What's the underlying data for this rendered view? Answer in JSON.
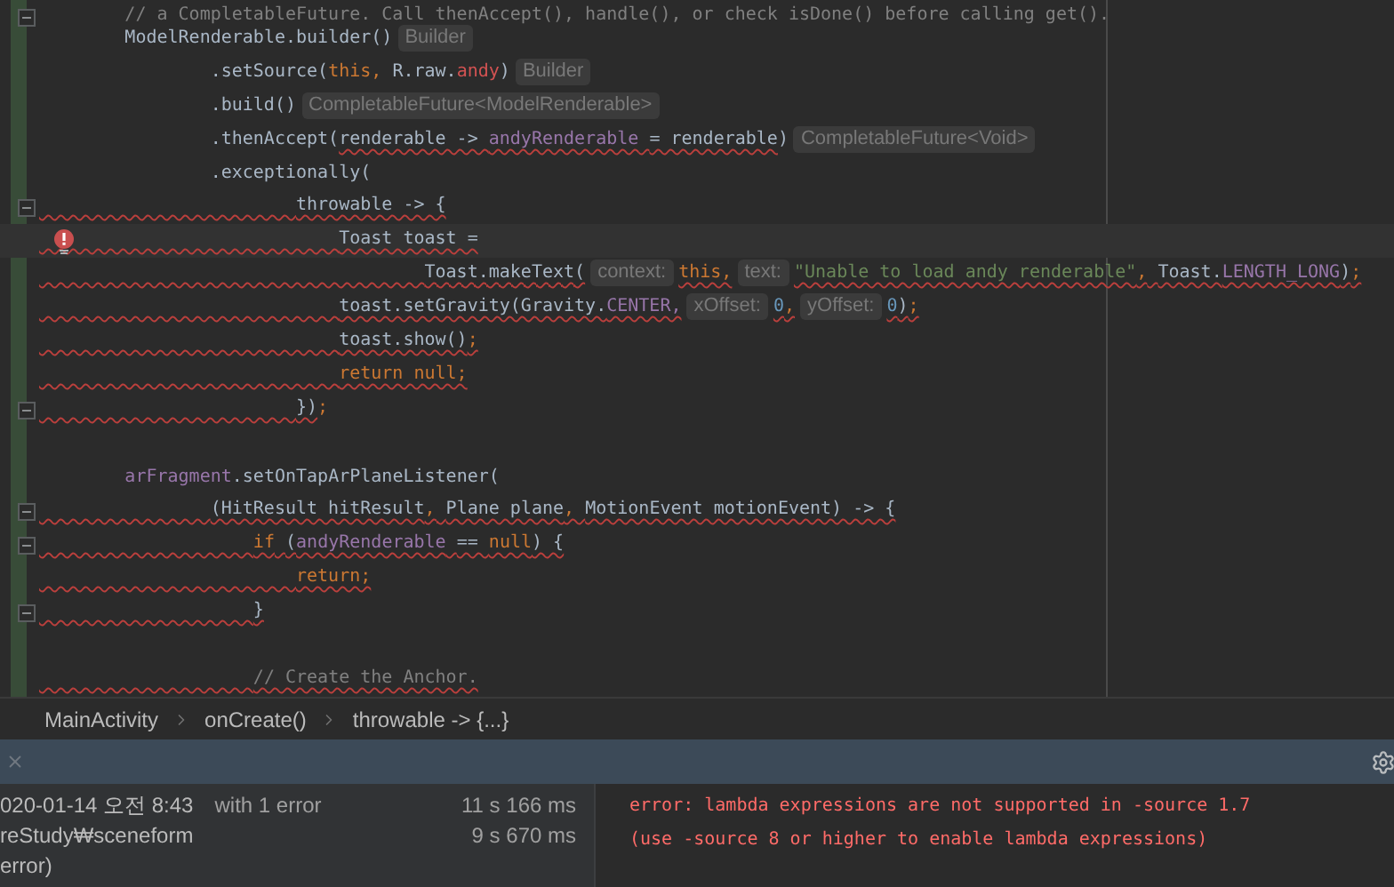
{
  "editor": {
    "lines": [
      {
        "current": false,
        "error_bulb": false,
        "fold": true,
        "tokens": [
          {
            "text": "        // a CompletableFuture. Call thenAccept(), handle(), or check isDone() before calling get().",
            "kind": "comment",
            "error": false
          }
        ]
      },
      {
        "current": false,
        "error_bulb": false,
        "fold": false,
        "tokens": [
          {
            "text": "        ModelRenderable.builder()",
            "kind": "plain",
            "error": false
          },
          {
            "text": "Builder",
            "kind": "hint"
          }
        ]
      },
      {
        "current": false,
        "error_bulb": false,
        "fold": false,
        "tokens": [
          {
            "text": "                .setSource(",
            "kind": "plain",
            "error": false
          },
          {
            "text": "this,",
            "kind": "keyword",
            "error": false
          },
          {
            "text": " R.raw.",
            "kind": "plain",
            "error": false
          },
          {
            "text": "andy",
            "kind": "resource",
            "error": false
          },
          {
            "text": ")",
            "kind": "plain",
            "error": false
          },
          {
            "text": "Builder",
            "kind": "hint"
          }
        ]
      },
      {
        "current": false,
        "error_bulb": false,
        "fold": false,
        "tokens": [
          {
            "text": "                .build()",
            "kind": "plain",
            "error": false
          },
          {
            "text": "CompletableFuture<ModelRenderable>",
            "kind": "hint"
          }
        ]
      },
      {
        "current": false,
        "error_bulb": false,
        "fold": false,
        "tokens": [
          {
            "text": "                .thenAccept(",
            "kind": "plain",
            "error": false
          },
          {
            "text": "renderable -> ",
            "kind": "plain",
            "error": true
          },
          {
            "text": "andyRenderable",
            "kind": "field",
            "error": true
          },
          {
            "text": " = renderable",
            "kind": "plain",
            "error": true
          },
          {
            "text": ")",
            "kind": "plain",
            "error": false
          },
          {
            "text": "CompletableFuture<Void>",
            "kind": "hint"
          }
        ]
      },
      {
        "current": false,
        "error_bulb": false,
        "fold": false,
        "tokens": [
          {
            "text": "                .exceptionally(",
            "kind": "plain",
            "error": false
          }
        ]
      },
      {
        "current": false,
        "error_bulb": false,
        "fold": true,
        "tokens": [
          {
            "text": "                        throwable -> {",
            "kind": "plain",
            "error": true
          }
        ]
      },
      {
        "current": true,
        "error_bulb": true,
        "fold": false,
        "tokens": [
          {
            "text": "                            Toast toast =",
            "kind": "plain",
            "error": true
          }
        ]
      },
      {
        "current": false,
        "error_bulb": false,
        "fold": false,
        "tokens": [
          {
            "text": "                                    Toast.makeText(",
            "kind": "plain",
            "error": true
          },
          {
            "text": "context:",
            "kind": "hint"
          },
          {
            "text": "this,",
            "kind": "keyword",
            "error": true
          },
          {
            "text": "text:",
            "kind": "hint"
          },
          {
            "text": "\"Unable to load andy renderable\"",
            "kind": "string",
            "error": true
          },
          {
            "text": ",",
            "kind": "keyword",
            "error": true
          },
          {
            "text": " Toast.",
            "kind": "plain",
            "error": true
          },
          {
            "text": "LENGTH_LONG",
            "kind": "field",
            "error": true
          },
          {
            "text": ")",
            "kind": "plain",
            "error": true
          },
          {
            "text": ";",
            "kind": "keyword",
            "error": true
          }
        ]
      },
      {
        "current": false,
        "error_bulb": false,
        "fold": false,
        "tokens": [
          {
            "text": "                            toast.setGravity(Gravity.",
            "kind": "plain",
            "error": true
          },
          {
            "text": "CENTER,",
            "kind": "field",
            "error": true
          },
          {
            "text": "xOffset:",
            "kind": "hint"
          },
          {
            "text": "0",
            "kind": "number",
            "error": true
          },
          {
            "text": ",",
            "kind": "keyword",
            "error": true
          },
          {
            "text": "yOffset:",
            "kind": "hint"
          },
          {
            "text": "0",
            "kind": "number",
            "error": true
          },
          {
            "text": ")",
            "kind": "plain",
            "error": true
          },
          {
            "text": ";",
            "kind": "keyword",
            "error": true
          }
        ]
      },
      {
        "current": false,
        "error_bulb": false,
        "fold": false,
        "tokens": [
          {
            "text": "                            toast.show()",
            "kind": "plain",
            "error": true
          },
          {
            "text": ";",
            "kind": "keyword",
            "error": true
          }
        ]
      },
      {
        "current": false,
        "error_bulb": false,
        "fold": false,
        "tokens": [
          {
            "text": "                            return null;",
            "kind": "keyword",
            "error": true
          }
        ]
      },
      {
        "current": false,
        "error_bulb": false,
        "fold": true,
        "tokens": [
          {
            "text": "                        })",
            "kind": "plain",
            "error": true
          },
          {
            "text": ";",
            "kind": "keyword",
            "error": false
          }
        ]
      },
      {
        "current": false,
        "error_bulb": false,
        "fold": false
      },
      {
        "current": false,
        "error_bulb": false,
        "fold": false,
        "tokens": [
          {
            "text": "        arFragment",
            "kind": "field",
            "error": false
          },
          {
            "text": ".setOnTapArPlaneListener(",
            "kind": "plain",
            "error": false
          }
        ]
      },
      {
        "current": false,
        "error_bulb": false,
        "fold": true,
        "tokens": [
          {
            "text": "                (HitResult hitResult",
            "kind": "plain",
            "error": true
          },
          {
            "text": ", ",
            "kind": "keyword",
            "error": true
          },
          {
            "text": "Plane plane",
            "kind": "plain",
            "error": true
          },
          {
            "text": ", ",
            "kind": "keyword",
            "error": true
          },
          {
            "text": "MotionEvent motionEvent) -> {",
            "kind": "plain",
            "error": true
          }
        ]
      },
      {
        "current": false,
        "error_bulb": false,
        "fold": true,
        "tokens": [
          {
            "text": "                    if",
            "kind": "keyword",
            "error": true
          },
          {
            "text": " (",
            "kind": "plain",
            "error": true
          },
          {
            "text": "andyRenderable",
            "kind": "field",
            "error": true
          },
          {
            "text": " == ",
            "kind": "plain",
            "error": true
          },
          {
            "text": "null",
            "kind": "keyword",
            "error": true
          },
          {
            "text": ") {",
            "kind": "plain",
            "error": true
          }
        ]
      },
      {
        "current": false,
        "error_bulb": false,
        "fold": false,
        "tokens": [
          {
            "text": "                        return;",
            "kind": "keyword",
            "error": true
          }
        ]
      },
      {
        "current": false,
        "error_bulb": false,
        "fold": true,
        "tokens": [
          {
            "text": "                    }",
            "kind": "plain",
            "error": true
          }
        ]
      },
      {
        "current": false,
        "error_bulb": false,
        "fold": false
      },
      {
        "current": false,
        "error_bulb": false,
        "fold": false,
        "tokens": [
          {
            "text": "                    // Create the Anchor.",
            "kind": "comment",
            "error": true
          }
        ]
      }
    ]
  },
  "breadcrumbs": [
    {
      "label": "MainActivity"
    },
    {
      "label": "onCreate()"
    },
    {
      "label": "throwable -> {...}"
    }
  ],
  "build_panel": {
    "rows": [
      {
        "label": "020-01-14 오전 8:43",
        "detail": "with 1 error",
        "time": "11 s 166 ms"
      },
      {
        "label": "reStudy₩sceneform",
        "time": "9 s 670 ms"
      },
      {
        "label": "error)"
      }
    ],
    "output": [
      "error: lambda expressions are not supported in -source 1.7",
      "(use -source 8 or higher to enable lambda expressions)"
    ]
  }
}
